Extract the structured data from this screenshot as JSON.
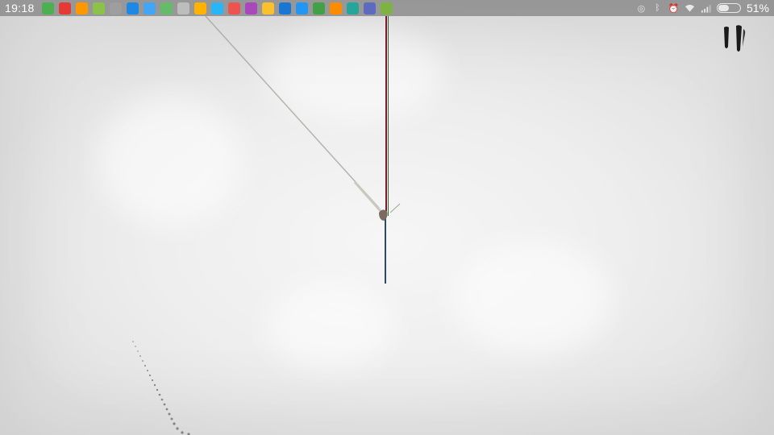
{
  "status_bar": {
    "time": "19:18",
    "battery_percent_label": "51%",
    "battery_level": 0.51,
    "notifications": [
      {
        "icon": "app-icon-green",
        "color": "#4caf50"
      },
      {
        "icon": "app-icon-red",
        "color": "#e53935"
      },
      {
        "icon": "app-icon-multicolor",
        "color": "#ff9800"
      },
      {
        "icon": "app-icon-multicolor",
        "color": "#8bc34a"
      },
      {
        "icon": "app-icon-gray",
        "color": "#9e9e9e"
      },
      {
        "icon": "app-icon-blue",
        "color": "#1e88e5"
      },
      {
        "icon": "app-icon-blue",
        "color": "#42a5f5"
      },
      {
        "icon": "download-icon",
        "color": "#66bb6a"
      },
      {
        "icon": "play-icon",
        "color": "#bdbdbd"
      },
      {
        "icon": "app-icon-multicolor",
        "color": "#ffb300"
      },
      {
        "icon": "app-icon-blue",
        "color": "#29b6f6"
      },
      {
        "icon": "app-icon-red",
        "color": "#ef5350"
      },
      {
        "icon": "app-icon-multicolor",
        "color": "#ab47bc"
      },
      {
        "icon": "app-icon-yellow",
        "color": "#fbc02d"
      },
      {
        "icon": "app-icon-blue",
        "color": "#1976d2"
      },
      {
        "icon": "app-icon-blue",
        "color": "#2196f3"
      },
      {
        "icon": "play-icon",
        "color": "#43a047"
      },
      {
        "icon": "app-icon-orange",
        "color": "#fb8c00"
      },
      {
        "icon": "app-icon-green",
        "color": "#26a69a"
      },
      {
        "icon": "shield-icon",
        "color": "#5c6bc0"
      },
      {
        "icon": "app-icon-green",
        "color": "#7cb342"
      }
    ],
    "system_icons": [
      "alarm-sync-icon",
      "bluetooth-icon",
      "alarm-clock-icon",
      "wifi-icon",
      "signal-icon"
    ]
  },
  "game": {
    "pause_icon": "pause-icon"
  },
  "colors": {
    "background": "#efefef",
    "status_bar": "#8c8c8c",
    "ink": "#1a1a1a",
    "rope": "#b0b0b0",
    "pole_red": "#8b1a2a",
    "pole_blue": "#2a4a66"
  }
}
